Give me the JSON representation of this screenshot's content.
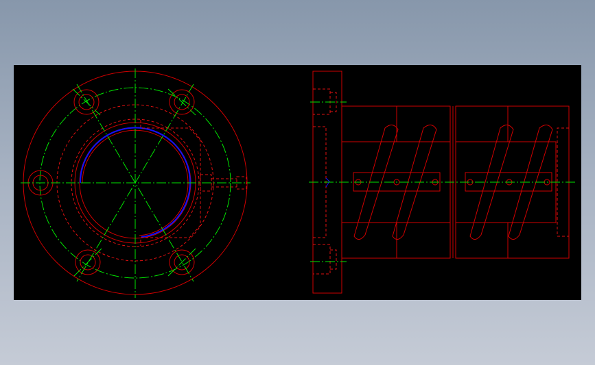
{
  "colors": {
    "background_gradient_top": "#8797ab",
    "background_gradient_bottom": "#c5cbd6",
    "canvas": "#000000",
    "visible_edges": "#d10000",
    "hidden_edges": "#e01010",
    "centerlines": "#00e600",
    "thread": "#1010ff"
  },
  "views": [
    {
      "name": "front-view",
      "description_visible": false
    },
    {
      "name": "side-view",
      "description_visible": false
    }
  ]
}
